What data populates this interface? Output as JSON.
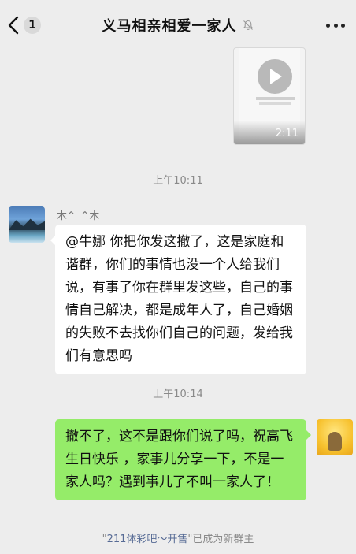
{
  "header": {
    "unread_count": "1",
    "title": "义马相亲相爱一家人"
  },
  "video": {
    "duration": "2:11"
  },
  "messages": {
    "time_1": "上午10:11",
    "sender_name": "木^_^木",
    "left_text": "@牛娜  你把你发这撤了，这是家庭和谐群，你们的事情也没一个人给我们说，有事了你在群里发这些，自己的事情自己解决，都是成年人了，自己婚姻的失败不去找你们自己的问题，发给我们有意思吗",
    "time_2": "上午10:14",
    "right_text": "撤不了，这不是跟你们说了吗，祝高飞生日快乐 ，家事儿分享一下，不是一家人吗？遇到事儿了不叫一家人了！"
  },
  "system_notice": {
    "quote_open": "\"",
    "group_name": "211体彩吧～开售",
    "quote_close": "\"",
    "suffix": "已成为新群主"
  },
  "icons": {
    "back": "chevron-left-icon",
    "mute": "bell-off-icon",
    "more": "more-dots-icon",
    "play": "play-icon"
  }
}
